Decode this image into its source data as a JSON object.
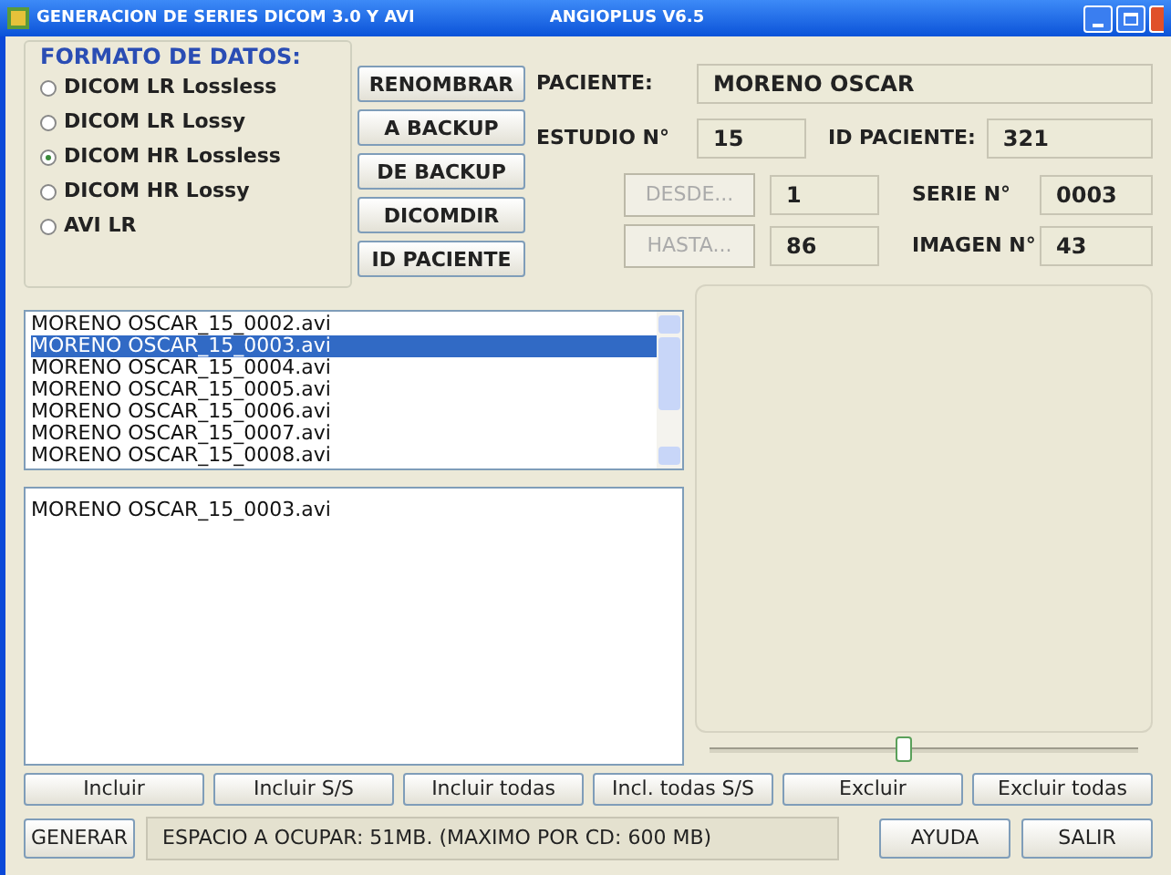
{
  "window": {
    "title": "GENERACION DE SERIES DICOM 3.0  Y AVI",
    "app_version": "ANGIOPLUS V6.5"
  },
  "format_group": {
    "title": "FORMATO DE DATOS:",
    "options": [
      {
        "label": "DICOM LR Lossless",
        "selected": false
      },
      {
        "label": "DICOM LR Lossy",
        "selected": false
      },
      {
        "label": "DICOM HR Lossless",
        "selected": true
      },
      {
        "label": "DICOM HR Lossy",
        "selected": false
      },
      {
        "label": "AVI LR",
        "selected": false
      }
    ]
  },
  "side_buttons": [
    "RENOMBRAR",
    "A BACKUP",
    "DE BACKUP",
    "DICOMDIR",
    "ID PACIENTE"
  ],
  "patient": {
    "label": "PACIENTE:",
    "value": "MORENO OSCAR"
  },
  "study": {
    "label": "ESTUDIO N°",
    "value": "15"
  },
  "patient_id": {
    "label": "ID PACIENTE:",
    "value": "321"
  },
  "from": {
    "button": "DESDE...",
    "disabled": true,
    "value": "1"
  },
  "to": {
    "button": "HASTA...",
    "disabled": true,
    "value": "86"
  },
  "series": {
    "label": "SERIE N°",
    "value": "0003"
  },
  "image": {
    "label": "IMAGEN N°",
    "value": "43"
  },
  "file_list": [
    {
      "name": "MORENO OSCAR_15_0002.avi",
      "selected": false
    },
    {
      "name": "MORENO OSCAR_15_0003.avi",
      "selected": true
    },
    {
      "name": "MORENO OSCAR_15_0004.avi",
      "selected": false
    },
    {
      "name": "MORENO OSCAR_15_0005.avi",
      "selected": false
    },
    {
      "name": "MORENO OSCAR_15_0006.avi",
      "selected": false
    },
    {
      "name": "MORENO OSCAR_15_0007.avi",
      "selected": false
    },
    {
      "name": "MORENO OSCAR_15_0008.avi",
      "selected": false
    }
  ],
  "chosen_list": [
    "MORENO OSCAR_15_0003.avi"
  ],
  "frame_slider": {
    "level": 0.45
  },
  "action_buttons": [
    "Incluir",
    "Incluir S/S",
    "Incluir todas",
    "Incl. todas S/S",
    "Excluir",
    "Excluir todas"
  ],
  "generate_button": "GENERAR",
  "status": "ESPACIO A OCUPAR: 51MB. (MAXIMO POR CD: 600 MB)",
  "help_button": "AYUDA",
  "exit_button": "SALIR"
}
